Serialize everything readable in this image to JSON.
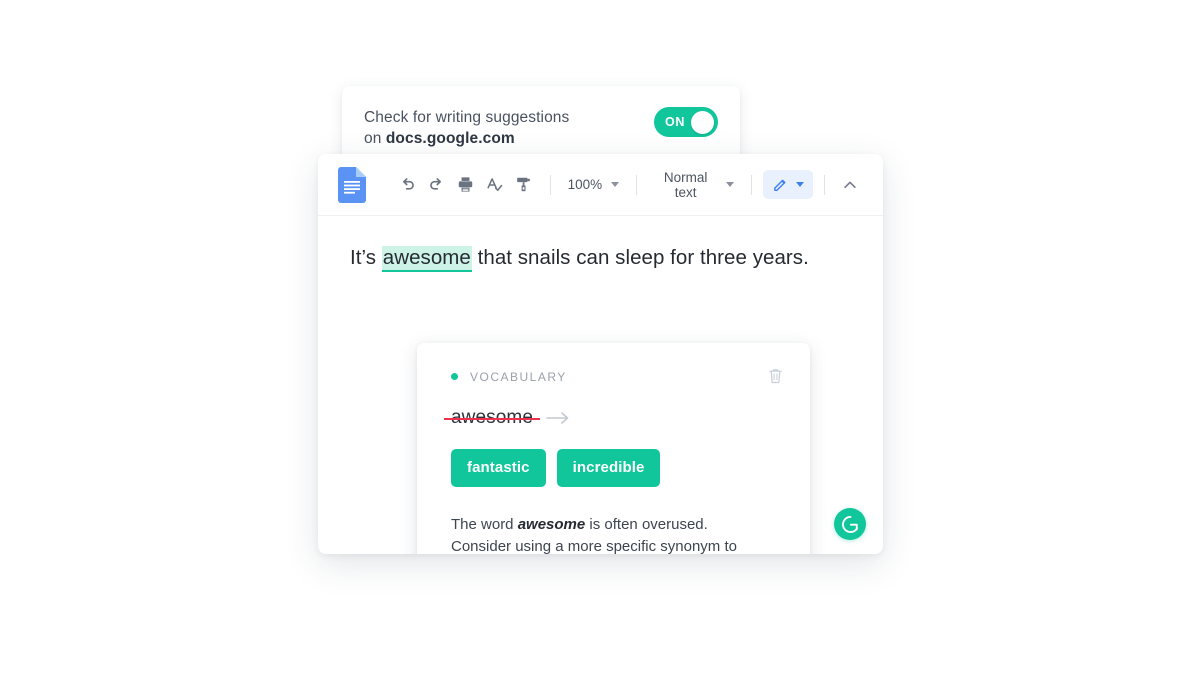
{
  "extension_popup": {
    "line1": "Check for writing suggestions",
    "line2_prefix": "on ",
    "domain": "docs.google.com",
    "toggle_label": "ON",
    "toggle_state": "on",
    "toggle_color": "#12c69c"
  },
  "docs_window": {
    "logo_name": "google-docs-icon",
    "toolbar": {
      "undo_label": "Undo",
      "redo_label": "Redo",
      "print_label": "Print",
      "spellcheck_label": "Spelling and grammar check",
      "paint_format_label": "Paint format",
      "zoom_value": "100%",
      "style_value": "Normal text",
      "edit_mode_label": "Editing",
      "collapse_label": "Hide the menus"
    },
    "document": {
      "sentence_before": "It’s ",
      "highlighted_word": "awesome",
      "sentence_after": " that snails can sleep for three years."
    },
    "grammarly_badge": "G"
  },
  "suggestion_card": {
    "category": "VOCABULARY",
    "category_color": "#12c69c",
    "delete_label": "Dismiss suggestion",
    "original_word": "awesome",
    "strikethrough_color": "#f0304f",
    "arrow": "→",
    "alternatives": [
      {
        "label": "fantastic"
      },
      {
        "label": "incredible"
      }
    ],
    "explanation_prefix": "The word ",
    "explanation_emphasis": "awesome",
    "explanation_suffix": " is often overused. Consider using a more specific synonym to improve the sharpness of your writing."
  }
}
